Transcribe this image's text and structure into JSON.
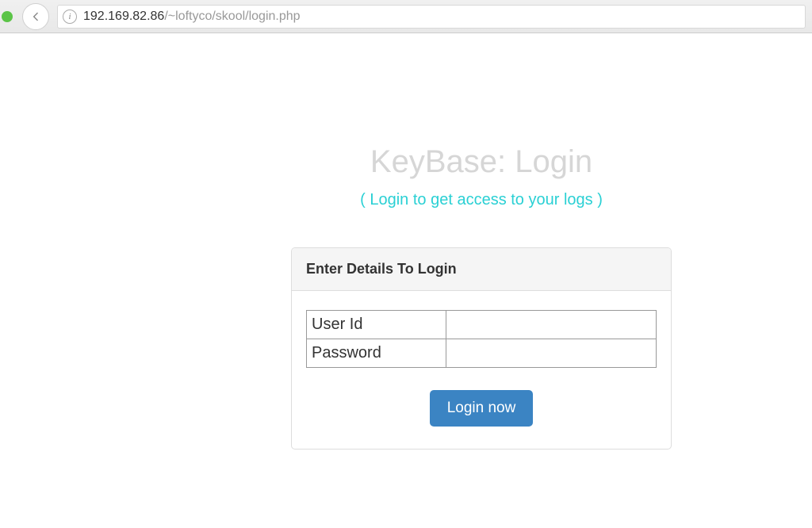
{
  "browser": {
    "url_host": "192.169.82.86",
    "url_path": "/~loftyco/skool/login.php"
  },
  "page": {
    "title": "KeyBase: Login",
    "subtitle": "( Login to get access to your logs )"
  },
  "panel": {
    "header": "Enter Details To Login",
    "fields": {
      "user_id": {
        "label": "User Id",
        "value": ""
      },
      "password": {
        "label": "Password",
        "value": ""
      }
    },
    "button_label": "Login now"
  }
}
